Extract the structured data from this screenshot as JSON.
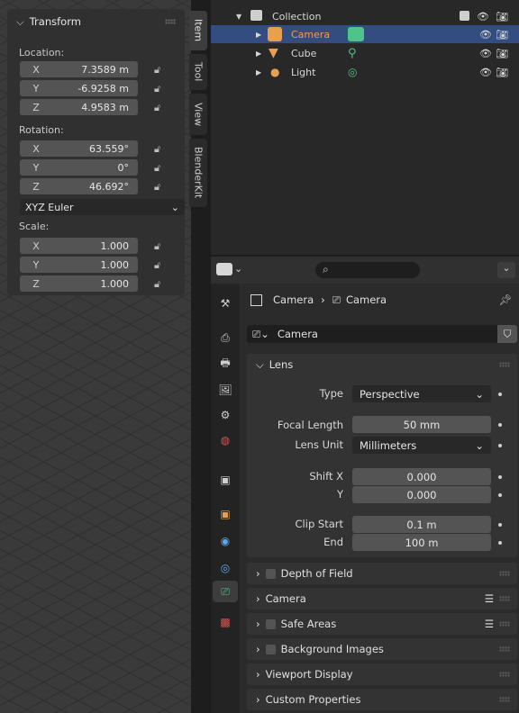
{
  "colors": {
    "accent": "#4772b3",
    "selected_row": "#334d80",
    "camera_orange": "#e8a050",
    "data_green": "#4fc48a"
  },
  "transform": {
    "title": "Transform",
    "location_label": "Location:",
    "location": [
      {
        "axis": "X",
        "value": "7.3589 m"
      },
      {
        "axis": "Y",
        "value": "-6.9258 m"
      },
      {
        "axis": "Z",
        "value": "4.9583 m"
      }
    ],
    "rotation_label": "Rotation:",
    "rotation": [
      {
        "axis": "X",
        "value": "63.559°"
      },
      {
        "axis": "Y",
        "value": "0°"
      },
      {
        "axis": "Z",
        "value": "46.692°"
      }
    ],
    "rotation_mode": "XYZ Euler",
    "scale_label": "Scale:",
    "scale": [
      {
        "axis": "X",
        "value": "1.000"
      },
      {
        "axis": "Y",
        "value": "1.000"
      },
      {
        "axis": "Z",
        "value": "1.000"
      }
    ]
  },
  "sidebar_tabs": [
    "Item",
    "Tool",
    "View",
    "BlenderKit"
  ],
  "outliner": {
    "collection": "Collection",
    "items": [
      {
        "label": "Camera"
      },
      {
        "label": "Cube"
      },
      {
        "label": "Light"
      }
    ]
  },
  "properties": {
    "breadcrumb_object": "Camera",
    "breadcrumb_data": "Camera",
    "datablock_name": "Camera",
    "lens_panel": "Lens",
    "type_label": "Type",
    "type_value": "Perspective",
    "focal_length_label": "Focal Length",
    "focal_length_value": "50 mm",
    "lens_unit_label": "Lens Unit",
    "lens_unit_value": "Millimeters",
    "shift_x_label": "Shift X",
    "shift_x_value": "0.000",
    "shift_y_label": "Y",
    "shift_y_value": "0.000",
    "clip_start_label": "Clip Start",
    "clip_start_value": "0.1 m",
    "clip_end_label": "End",
    "clip_end_value": "100 m",
    "subpanels": [
      "Depth of Field",
      "Camera",
      "Safe Areas",
      "Background Images",
      "Viewport Display",
      "Custom Properties"
    ]
  }
}
